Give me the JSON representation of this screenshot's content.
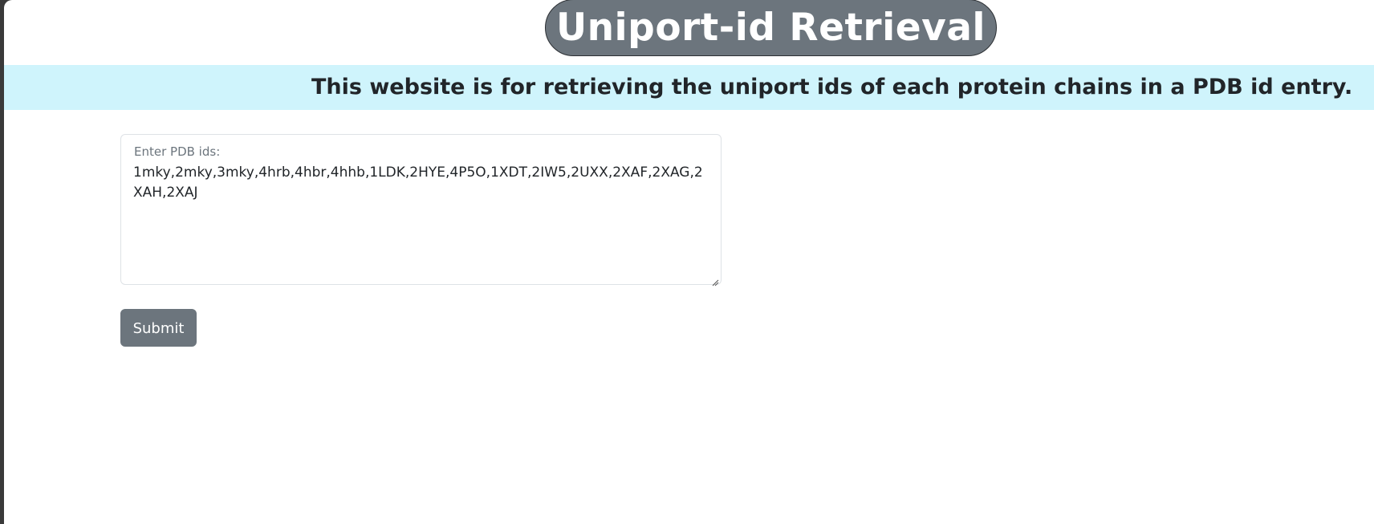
{
  "header": {
    "title": "Uniport-id Retrieval"
  },
  "banner": {
    "text": "This website is for retrieving the uniport ids of each protein chains in a PDB id entry."
  },
  "form": {
    "label": "Enter PDB ids:",
    "value": "1mky,2mky,3mky,4hrb,4hbr,4hhb,1LDK,2HYE,4P5O,1XDT,2IW5,2UXX,2XAF,2XAG,2XAH,2XAJ",
    "submit_label": "Submit"
  },
  "colors": {
    "pill_background": "#6c757d",
    "banner_background": "#cff4fc",
    "button_background": "#6c757d"
  },
  "icons": {
    "resize": "resize-handle-icon"
  }
}
